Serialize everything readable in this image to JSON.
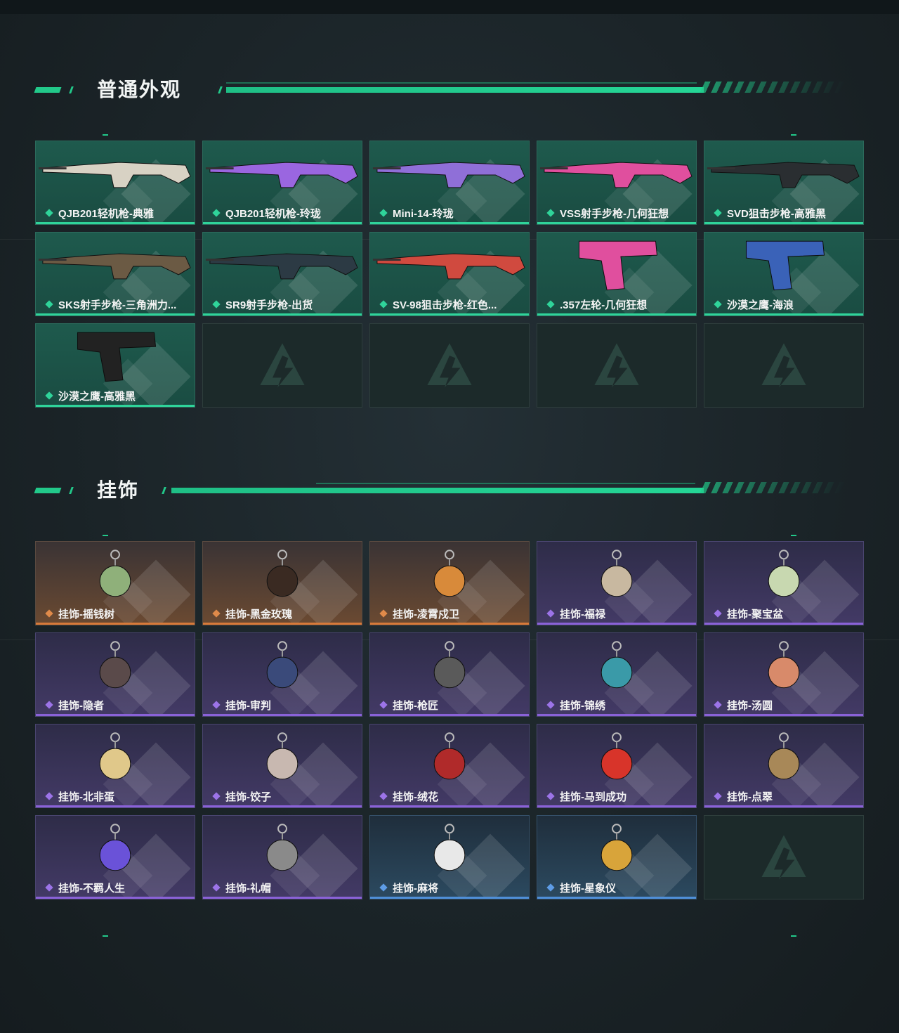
{
  "colors": {
    "accent": "#22c98a",
    "green_rarity": "#2fd49a",
    "orange_rarity": "#d87a3a",
    "purple_rarity": "#8a62d8",
    "blue_rarity": "#4f8fd8"
  },
  "sections": [
    {
      "title": "普通外观",
      "items": [
        {
          "label": "QJB201轻机枪-典雅",
          "rarity": "green",
          "icon": "rifle-skin-image"
        },
        {
          "label": "QJB201轻机枪-玲珑",
          "rarity": "green",
          "icon": "rifle-skin-image"
        },
        {
          "label": "Mini-14-玲珑",
          "rarity": "green",
          "icon": "rifle-skin-image"
        },
        {
          "label": "VSS射手步枪-几何狂想",
          "rarity": "green",
          "icon": "rifle-skin-image"
        },
        {
          "label": "SVD狙击步枪-高雅黑",
          "rarity": "green",
          "icon": "rifle-skin-image"
        },
        {
          "label": "SKS射手步枪-三角洲力...",
          "rarity": "green",
          "icon": "rifle-skin-image"
        },
        {
          "label": "SR9射手步枪-出货",
          "rarity": "green",
          "icon": "rifle-skin-image"
        },
        {
          "label": "SV-98狙击步枪-红色...",
          "rarity": "green",
          "icon": "rifle-skin-image"
        },
        {
          "label": ".357左轮-几何狂想",
          "rarity": "green",
          "icon": "revolver-skin-image"
        },
        {
          "label": "沙漠之鹰-海浪",
          "rarity": "green",
          "icon": "pistol-skin-image"
        },
        {
          "label": "沙漠之鹰-高雅黑",
          "rarity": "green",
          "icon": "pistol-skin-image"
        },
        {
          "empty": true
        },
        {
          "empty": true
        },
        {
          "empty": true
        },
        {
          "empty": true
        }
      ]
    },
    {
      "title": "挂饰",
      "items": [
        {
          "label": "挂饰-摇钱树",
          "rarity": "orange",
          "icon": "charm-image"
        },
        {
          "label": "挂饰-黑金玫瑰",
          "rarity": "orange",
          "icon": "charm-image"
        },
        {
          "label": "挂饰-凌霄戍卫",
          "rarity": "orange",
          "icon": "charm-image"
        },
        {
          "label": "挂饰-福禄",
          "rarity": "purple",
          "icon": "charm-image"
        },
        {
          "label": "挂饰-聚宝盆",
          "rarity": "purple",
          "icon": "charm-image"
        },
        {
          "label": "挂饰-隐者",
          "rarity": "purple",
          "icon": "charm-image"
        },
        {
          "label": "挂饰-审判",
          "rarity": "purple",
          "icon": "charm-image"
        },
        {
          "label": "挂饰-枪匠",
          "rarity": "purple",
          "icon": "charm-image"
        },
        {
          "label": "挂饰-锦绣",
          "rarity": "purple",
          "icon": "charm-image"
        },
        {
          "label": "挂饰-汤圆",
          "rarity": "purple",
          "icon": "charm-image"
        },
        {
          "label": "挂饰-北非蛋",
          "rarity": "purple",
          "icon": "charm-image"
        },
        {
          "label": "挂饰-饺子",
          "rarity": "purple",
          "icon": "charm-image"
        },
        {
          "label": "挂饰-绒花",
          "rarity": "purple",
          "icon": "charm-image"
        },
        {
          "label": "挂饰-马到成功",
          "rarity": "purple",
          "icon": "charm-image"
        },
        {
          "label": "挂饰-点翠",
          "rarity": "purple",
          "icon": "charm-image"
        },
        {
          "label": "挂饰-不羁人生",
          "rarity": "purple",
          "icon": "charm-image"
        },
        {
          "label": "挂饰-礼帽",
          "rarity": "purple",
          "icon": "charm-image"
        },
        {
          "label": "挂饰-麻将",
          "rarity": "blue",
          "icon": "charm-image"
        },
        {
          "label": "挂饰-星象仪",
          "rarity": "blue",
          "icon": "charm-image"
        },
        {
          "empty": true
        }
      ]
    }
  ]
}
